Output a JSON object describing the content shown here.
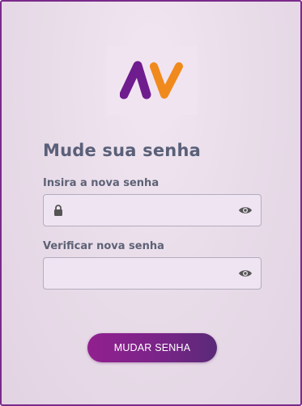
{
  "logo": {
    "text": "AV",
    "colors": {
      "a": "#6f1c8f",
      "v": "#f08a1c"
    }
  },
  "form": {
    "title": "Mude sua senha",
    "new_password": {
      "label": "Insira a nova senha",
      "value": "",
      "placeholder": ""
    },
    "verify_password": {
      "label": "Verificar nova senha",
      "value": "",
      "placeholder": ""
    },
    "submit_label": "MUDAR SENHA"
  },
  "icons": {
    "lock": "lock-icon",
    "eye": "eye-icon"
  },
  "colors": {
    "accent": "#8a218d",
    "border": "#7a2a8a"
  }
}
